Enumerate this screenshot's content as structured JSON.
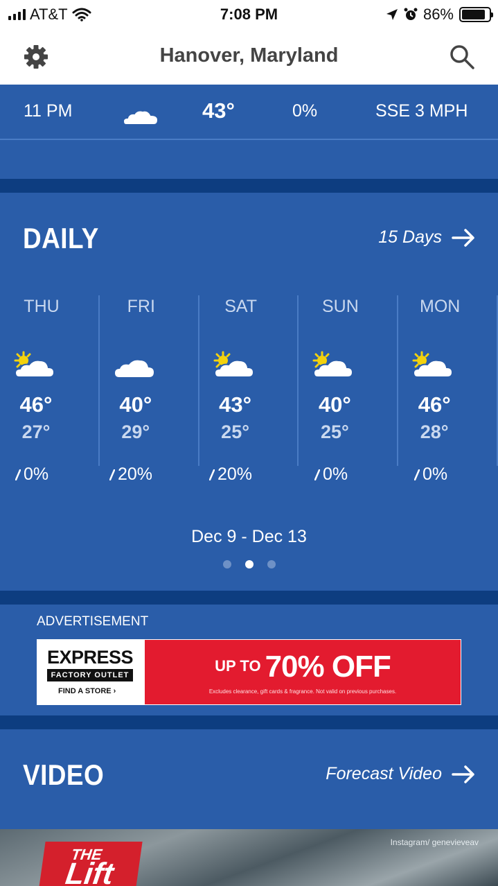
{
  "status_bar": {
    "carrier": "AT&T",
    "time": "7:08 PM",
    "battery": "86%",
    "battery_level": 0.86
  },
  "header": {
    "title": "Hanover, Maryland",
    "settings_icon": "gear-icon",
    "search_icon": "search-icon"
  },
  "hourly": {
    "time": "11 PM",
    "icon": "moon-cloud-icon",
    "temp": "43°",
    "precip": "0%",
    "wind": "SSE 3 MPH"
  },
  "daily": {
    "title": "DAILY",
    "link_label": "15 Days",
    "days": [
      {
        "name": "THU",
        "icon": "sun-cloud-icon",
        "hi": "46°",
        "lo": "27°",
        "precip": "0%"
      },
      {
        "name": "FRI",
        "icon": "cloud-icon",
        "hi": "40°",
        "lo": "29°",
        "precip": "20%"
      },
      {
        "name": "SAT",
        "icon": "sun-cloud-icon",
        "hi": "43°",
        "lo": "25°",
        "precip": "20%"
      },
      {
        "name": "SUN",
        "icon": "sun-cloud-icon",
        "hi": "40°",
        "lo": "25°",
        "precip": "0%"
      },
      {
        "name": "MON",
        "icon": "sun-cloud-icon",
        "hi": "46°",
        "lo": "28°",
        "precip": "0%"
      }
    ],
    "date_range": "Dec 9 - Dec 13",
    "page_count": 3,
    "active_page": 2
  },
  "ad": {
    "label": "ADVERTISEMENT",
    "brand": "EXPRESS",
    "brand_sub": "FACTORY OUTLET",
    "find_store": "FIND A STORE ›",
    "up_to": "UP TO",
    "offer": "70% OFF",
    "fine_print": "Excludes clearance, gift cards & fragrance. Not valid on previous purchases."
  },
  "video": {
    "title": "VIDEO",
    "link_label": "Forecast Video",
    "thumb_logo_top": "THE",
    "thumb_logo_bottom": "Lift",
    "thumb_credit": "Instagram/ genevieveav"
  },
  "colors": {
    "primary_blue": "#2a5da9",
    "dark_blue": "#0d3d80",
    "ad_red": "#e31b2f"
  }
}
